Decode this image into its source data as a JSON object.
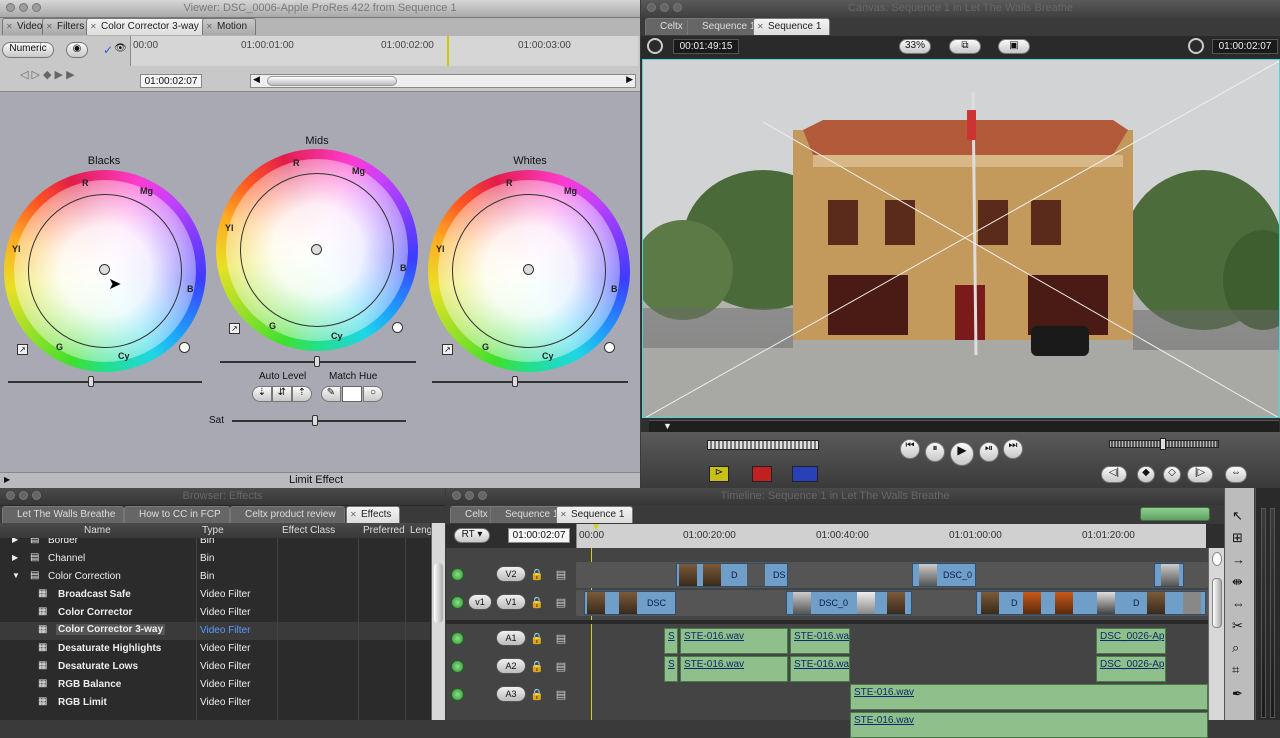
{
  "viewer": {
    "title": "Viewer: DSC_0006-Apple ProRes 422 from Sequence 1",
    "tabs": [
      "Video",
      "Filters",
      "Color Corrector 3-way",
      "Motion"
    ],
    "numeric": "Numeric",
    "ruler": [
      "00:00",
      "01:00:01:00",
      "01:00:02:00",
      "01:00:03:00"
    ],
    "timecode": "01:00:02:07",
    "wheels": {
      "blacks": "Blacks",
      "mids": "Mids",
      "whites": "Whites",
      "labels": {
        "r": "R",
        "mg": "Mg",
        "yl": "Yl",
        "b": "B",
        "g": "G",
        "cy": "Cy"
      }
    },
    "auto_level": "Auto Level",
    "match_hue": "Match Hue",
    "sat": "Sat",
    "limit_effect": "Limit Effect"
  },
  "canvas": {
    "title": "Canvas: Sequence 1 in Let The Walls Breathe",
    "tabs": [
      "Celtx",
      "Sequence 1",
      "Sequence 1"
    ],
    "duration": "00:01:49:15",
    "zoom": "33%",
    "timecode": "01:00:02:07"
  },
  "browser": {
    "title": "Browser: Effects",
    "tabs": [
      "Let The Walls Breathe",
      "How to CC in FCP",
      "Celtx product review",
      "Effects"
    ],
    "columns": [
      "Name",
      "Type",
      "Effect Class",
      "Preferred",
      "Leng"
    ],
    "rows": [
      {
        "name": "Border",
        "type": "Bin"
      },
      {
        "name": "Channel",
        "type": "Bin"
      },
      {
        "name": "Color Correction",
        "type": "Bin"
      },
      {
        "name": "Broadcast Safe",
        "type": "Video Filter"
      },
      {
        "name": "Color Corrector",
        "type": "Video Filter"
      },
      {
        "name": "Color Corrector 3-way",
        "type": "Video Filter"
      },
      {
        "name": "Desaturate Highlights",
        "type": "Video Filter"
      },
      {
        "name": "Desaturate Lows",
        "type": "Video Filter"
      },
      {
        "name": "RGB Balance",
        "type": "Video Filter"
      },
      {
        "name": "RGB Limit",
        "type": "Video Filter"
      }
    ]
  },
  "timeline": {
    "title": "Timeline: Sequence 1 in Let The Walls Breathe",
    "tabs": [
      "Celtx",
      "Sequence 1",
      "Sequence 1"
    ],
    "rt": "RT",
    "timecode": "01:00:02:07",
    "ruler": [
      "00:00",
      "01:00:20:00",
      "01:00:40:00",
      "01:01:00:00",
      "01:01:20:00"
    ],
    "tracks": {
      "v2": "V2",
      "v1": "V1",
      "v1src": "v1",
      "a1": "A1",
      "a2": "A2",
      "a3": "A3"
    },
    "clips": {
      "dsc_0": "DSC_0",
      "dsc_0b": "DSC_0",
      "dsc_short": "DSC",
      "d": "D",
      "ds": "DS",
      "ste1": "STE-016.wav",
      "ste2": "STE-016.wav",
      "ste3": "STE-016.wav",
      "ste4": "STE-016.wav",
      "ste5": "STE-016.wav",
      "ste6": "STE-016.wav",
      "dsc26a": "DSC_0026-App",
      "dsc26b": "DSC_0026-App"
    }
  },
  "colors": {
    "accent": "#4fd6d6",
    "audio_clip": "#8fbf8b",
    "video_clip": "#6f9fc8"
  }
}
